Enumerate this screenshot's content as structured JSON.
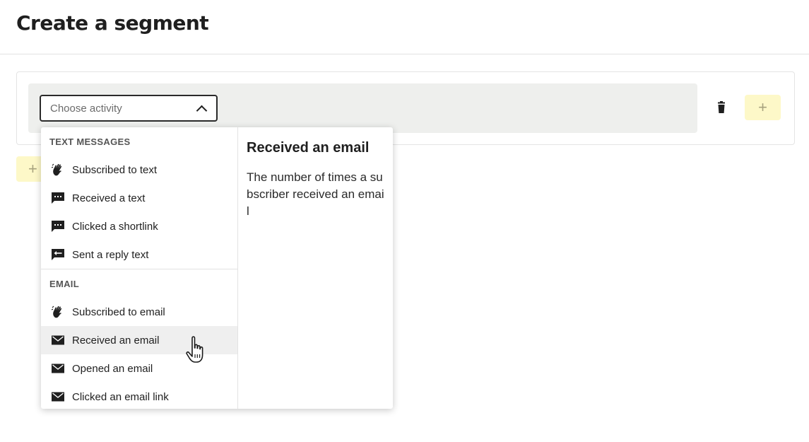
{
  "page": {
    "title": "Create a segment"
  },
  "rule": {
    "activity_placeholder": "Choose activity",
    "delete_icon": "trash-icon",
    "add_condition_label": "+"
  },
  "add_group": {
    "label": "+"
  },
  "dropdown": {
    "sections": [
      {
        "title": "TEXT MESSAGES",
        "items": [
          {
            "label": "Subscribed to text",
            "icon": "hand-wave-icon"
          },
          {
            "label": "Received a text",
            "icon": "chat-bubble-icon"
          },
          {
            "label": "Clicked a shortlink",
            "icon": "chat-bubble-icon"
          },
          {
            "label": "Sent a reply text",
            "icon": "reply-bubble-icon"
          }
        ]
      },
      {
        "title": "EMAIL",
        "items": [
          {
            "label": "Subscribed to email",
            "icon": "hand-wave-icon"
          },
          {
            "label": "Received an email",
            "icon": "envelope-icon",
            "highlighted": true
          },
          {
            "label": "Opened an email",
            "icon": "envelope-icon"
          },
          {
            "label": "Clicked an email link",
            "icon": "envelope-icon"
          }
        ]
      }
    ],
    "detail": {
      "title": "Received an email",
      "description": "The number of times a subscriber received an email"
    }
  },
  "colors": {
    "accent_yellow": "#fdf8c8",
    "row_background": "#eeefed",
    "highlight": "#efefef"
  }
}
